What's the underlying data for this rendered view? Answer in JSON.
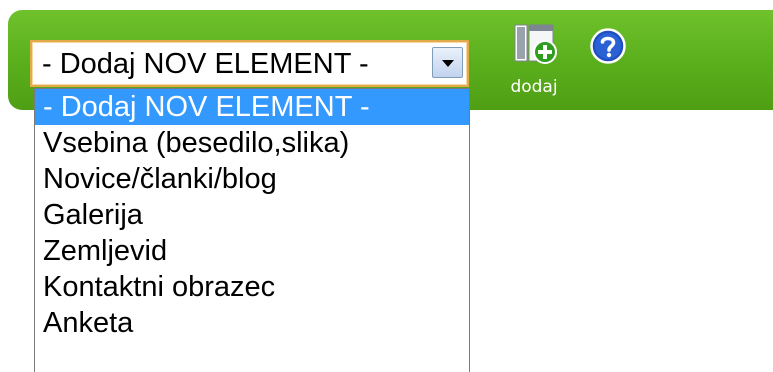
{
  "select": {
    "value": "- Dodaj NOV ELEMENT -",
    "options": [
      "- Dodaj NOV ELEMENT -",
      "Vsebina (besedilo,slika)",
      "Novice/članki/blog",
      "Galerija",
      "Zemljevid",
      "Kontaktni obrazec",
      "Anketa"
    ],
    "selected_index": 0
  },
  "toolbar": {
    "add_label": "dodaj",
    "add_icon": "add-page-icon",
    "help_icon": "help-icon"
  },
  "colors": {
    "toolbar_green": "#5aae1c",
    "selected_option": "#3399ff",
    "select_border": "#e4a94a",
    "help_blue": "#1f4fbf"
  }
}
